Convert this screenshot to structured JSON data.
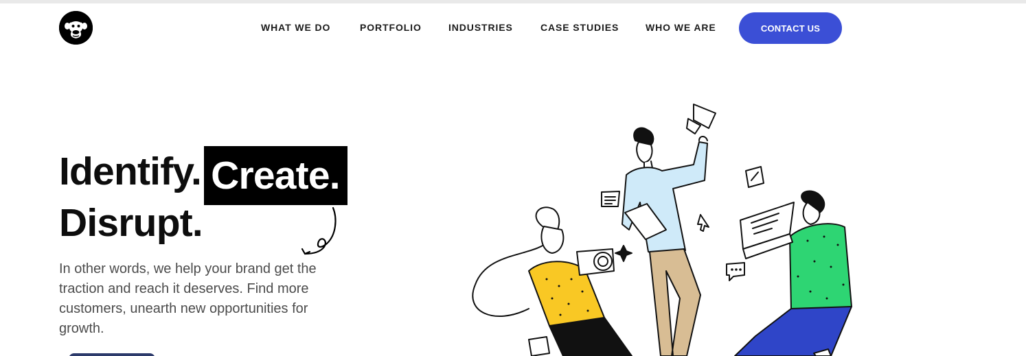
{
  "nav": {
    "items": [
      {
        "label": "WHAT WE DO"
      },
      {
        "label": "PORTFOLIO"
      },
      {
        "label": "INDUSTRIES"
      },
      {
        "label": "CASE STUDIES"
      },
      {
        "label": "WHO WE ARE"
      }
    ],
    "cta_label": "CONTACT US"
  },
  "logo": {
    "icon": "chimpanzee-logo-icon"
  },
  "hero": {
    "headline_part1": "Identify.",
    "headline_highlight": "Create.",
    "headline_part2": "Disrupt.",
    "subtext": "In other words, we help your brand get the traction and reach it deserves. Find more customers, unearth new opportunities for growth."
  },
  "colors": {
    "accent": "#3b4fd6",
    "yellow": "#f9c824",
    "green": "#2ed573",
    "light_blue": "#cfeaf9",
    "tan": "#d8bd94",
    "navy": "#2f45c8"
  }
}
